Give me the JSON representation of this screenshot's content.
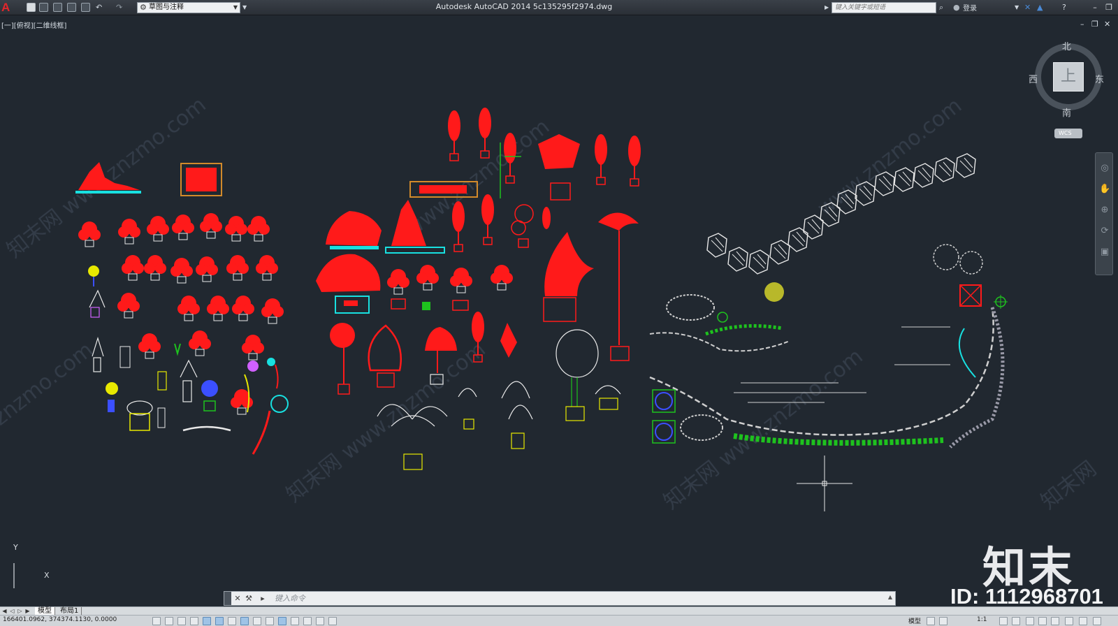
{
  "app": {
    "title": "Autodesk AutoCAD 2014    5c135295f2974.dwg",
    "logo_letter": "A"
  },
  "quick_access": {
    "workspace": "草图与注释",
    "search_placeholder": "键入关键字或短语",
    "login": "登录"
  },
  "viewport": {
    "label": "[一][俯视][二维线框]"
  },
  "viewcube": {
    "top_face": "上",
    "north": "北",
    "south": "南",
    "east": "东",
    "west": "西",
    "wcs": "WCS"
  },
  "ucs": {
    "x": "X",
    "y": "Y"
  },
  "watermark": {
    "logo": "知末",
    "id": "ID: 1112968701",
    "diagonal_text": "知末网 www.znzmo.com"
  },
  "command_line": {
    "placeholder": "键入命令"
  },
  "layout_tabs": [
    {
      "label": "模型",
      "active": true
    },
    {
      "label": "布局1",
      "active": false
    }
  ],
  "status_bar": {
    "coordinates": "166401.0962, 374374.1130, 0.0000",
    "model_label": "模型",
    "scale": "1:1"
  },
  "colors": {
    "background": "#212830",
    "red": "#ff1a1a",
    "yellow": "#e8e800",
    "green": "#1ec21e",
    "cyan": "#18e0e0",
    "white": "#e8e8e8",
    "blue": "#3b4fff",
    "orange": "#d28a2a"
  },
  "icons": [
    "new-icon",
    "open-icon",
    "save-icon",
    "saveas-icon",
    "plot-icon",
    "undo-icon",
    "redo-icon",
    "gear-icon",
    "binoculars-icon",
    "user-icon",
    "help-icon",
    "close-icon",
    "minimize-icon",
    "restore-icon",
    "pan-icon",
    "zoom-icon",
    "orbit-icon"
  ]
}
